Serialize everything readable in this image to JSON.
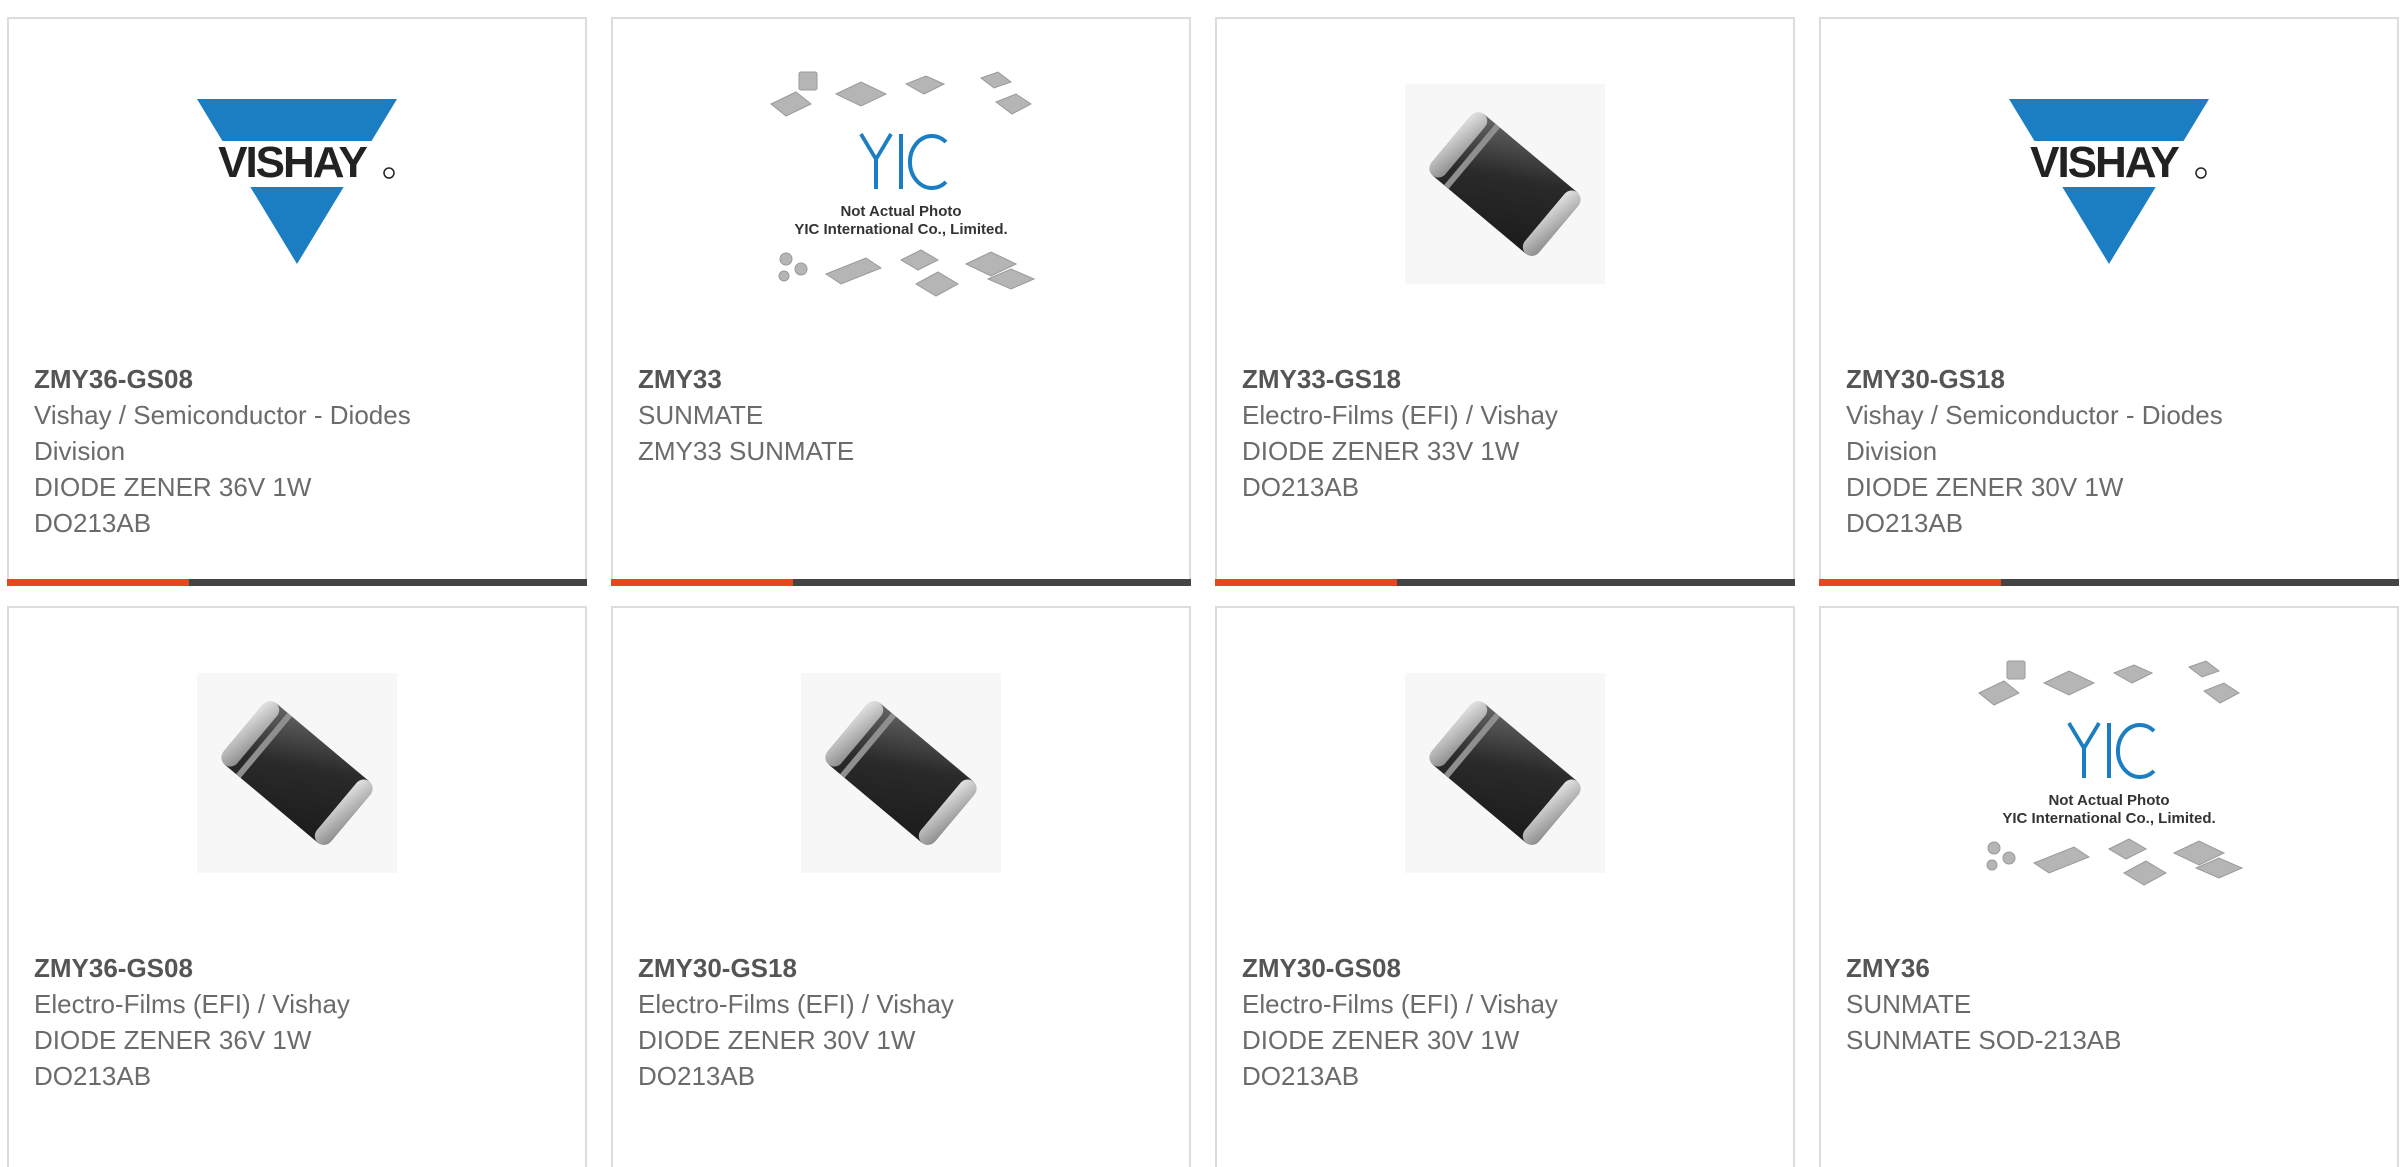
{
  "colors": {
    "accent": "#e8461f",
    "bar": "#444444",
    "border": "#dcdcdc",
    "vishay_blue": "#1b7ec3"
  },
  "cards": [
    {
      "part": "ZMY36-GS08",
      "lines": [
        "Vishay / Semiconductor - Diodes",
        "Division",
        "DIODE ZENER 36V 1W",
        "DO213AB"
      ],
      "image": "vishay-logo"
    },
    {
      "part": "ZMY33",
      "lines": [
        "SUNMATE",
        "ZMY33 SUNMATE"
      ],
      "image": "yic-placeholder"
    },
    {
      "part": "ZMY33-GS18",
      "lines": [
        "Electro-Films (EFI) / Vishay",
        "DIODE ZENER 33V 1W",
        "DO213AB"
      ],
      "image": "diode-photo"
    },
    {
      "part": "ZMY30-GS18",
      "lines": [
        "Vishay / Semiconductor - Diodes",
        "Division",
        "DIODE ZENER 30V 1W",
        "DO213AB"
      ],
      "image": "vishay-logo"
    },
    {
      "part": "ZMY36-GS08",
      "lines": [
        "Electro-Films (EFI) / Vishay",
        "DIODE ZENER 36V 1W",
        "DO213AB"
      ],
      "image": "diode-photo"
    },
    {
      "part": "ZMY30-GS18",
      "lines": [
        "Electro-Films (EFI) / Vishay",
        "DIODE ZENER 30V 1W",
        "DO213AB"
      ],
      "image": "diode-photo"
    },
    {
      "part": "ZMY30-GS08",
      "lines": [
        "Electro-Films (EFI) / Vishay",
        "DIODE ZENER 30V 1W",
        "DO213AB"
      ],
      "image": "diode-photo"
    },
    {
      "part": "ZMY36",
      "lines": [
        "SUNMATE",
        "SUNMATE SOD-213AB"
      ],
      "image": "yic-placeholder"
    }
  ],
  "logos": {
    "vishay": "VISHAY",
    "yic_brand": "YIC",
    "yic_note": "Not Actual Photo",
    "yic_company": "YIC International Co., Limited."
  }
}
